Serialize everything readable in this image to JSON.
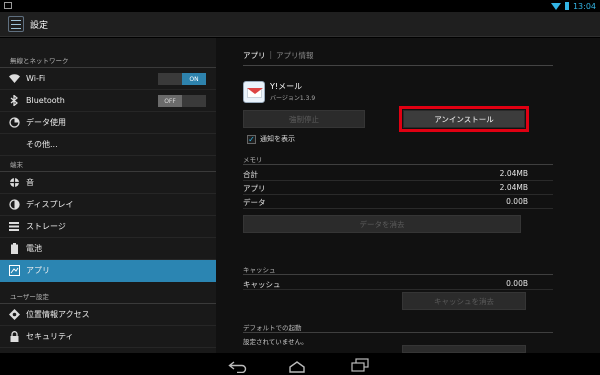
{
  "status": {
    "time": "13:04"
  },
  "actionbar": {
    "title": "設定"
  },
  "sidebar": {
    "headers": [
      "無線とネットワーク",
      "端末",
      "ユーザー設定"
    ],
    "items": [
      {
        "label": "Wi-Fi",
        "icon": "wifi-icon",
        "toggle": "ON"
      },
      {
        "label": "Bluetooth",
        "icon": "bluetooth-icon",
        "toggle": "OFF"
      },
      {
        "label": "データ使用",
        "icon": "data-usage-icon"
      },
      {
        "label": "その他...",
        "icon": ""
      },
      {
        "label": "音",
        "icon": "sound-icon"
      },
      {
        "label": "ディスプレイ",
        "icon": "display-icon"
      },
      {
        "label": "ストレージ",
        "icon": "storage-icon"
      },
      {
        "label": "電池",
        "icon": "battery-icon"
      },
      {
        "label": "アプリ",
        "icon": "apps-icon",
        "selected": true
      },
      {
        "label": "位置情報アクセス",
        "icon": "location-icon"
      },
      {
        "label": "セキュリティ",
        "icon": "lock-icon"
      }
    ]
  },
  "detail": {
    "tabs": {
      "active": "アプリ",
      "separator": "|",
      "inactive": "アプリ情報"
    },
    "app": {
      "name": "Y!メール",
      "version": "バージョン1.3.9"
    },
    "buttons": {
      "force_stop": "強制停止",
      "uninstall": "アンインストール"
    },
    "notify_label": "通知を表示",
    "memory": {
      "header": "メモリ",
      "rows": [
        {
          "label": "合計",
          "value": "2.04MB"
        },
        {
          "label": "アプリ",
          "value": "2.04MB"
        },
        {
          "label": "データ",
          "value": "0.00B"
        }
      ],
      "clear_data": "データを消去"
    },
    "cache": {
      "header": "キャッシュ",
      "row": {
        "label": "キャッシュ",
        "value": "0.00B"
      },
      "clear_cache": "キャッシュを消去"
    },
    "defaults": {
      "header": "デフォルトでの起動",
      "text": "設定されていません。"
    }
  },
  "accent_color": "#33b5e5",
  "highlight_color": "#e00012"
}
